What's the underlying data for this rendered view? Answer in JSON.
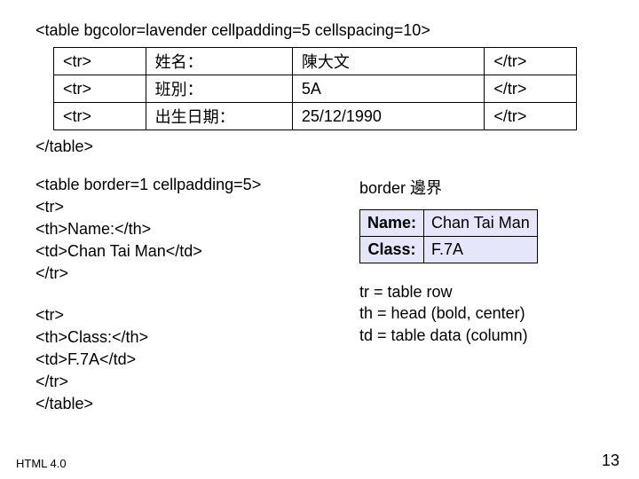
{
  "top_code": "<table bgcolor=lavender cellpadding=5 cellspacing=10>",
  "top_table": {
    "rows": [
      {
        "c1": "<tr>",
        "c2": "姓名：",
        "c3": "陳大文",
        "c4": "</tr>"
      },
      {
        "c1": "<tr>",
        "c2": "班別：",
        "c3": "5A",
        "c4": "</tr>"
      },
      {
        "c1": "<tr>",
        "c2": "出生日期：",
        "c3": "25/12/1990",
        "c4": "</tr>"
      }
    ]
  },
  "end_table": "</table>",
  "code_block_1": [
    "<table border=1 cellpadding=5>",
    "<tr>",
    "<th>Name:</th>",
    "<td>Chan Tai Man</td>",
    "</tr>"
  ],
  "code_block_2": [
    "<tr>",
    "<th>Class:</th>",
    "<td>F.7A</td>",
    "</tr>",
    "</table>"
  ],
  "border_label": "border 邊界",
  "demo_table": {
    "rows": [
      {
        "th": "Name:",
        "td": "Chan Tai Man"
      },
      {
        "th": "Class:",
        "td": "F.7A"
      }
    ]
  },
  "notes": [
    "tr = table row",
    "th = head (bold, center)",
    "td = table data (column)"
  ],
  "footer_left": "HTML 4.0",
  "footer_right": "13"
}
